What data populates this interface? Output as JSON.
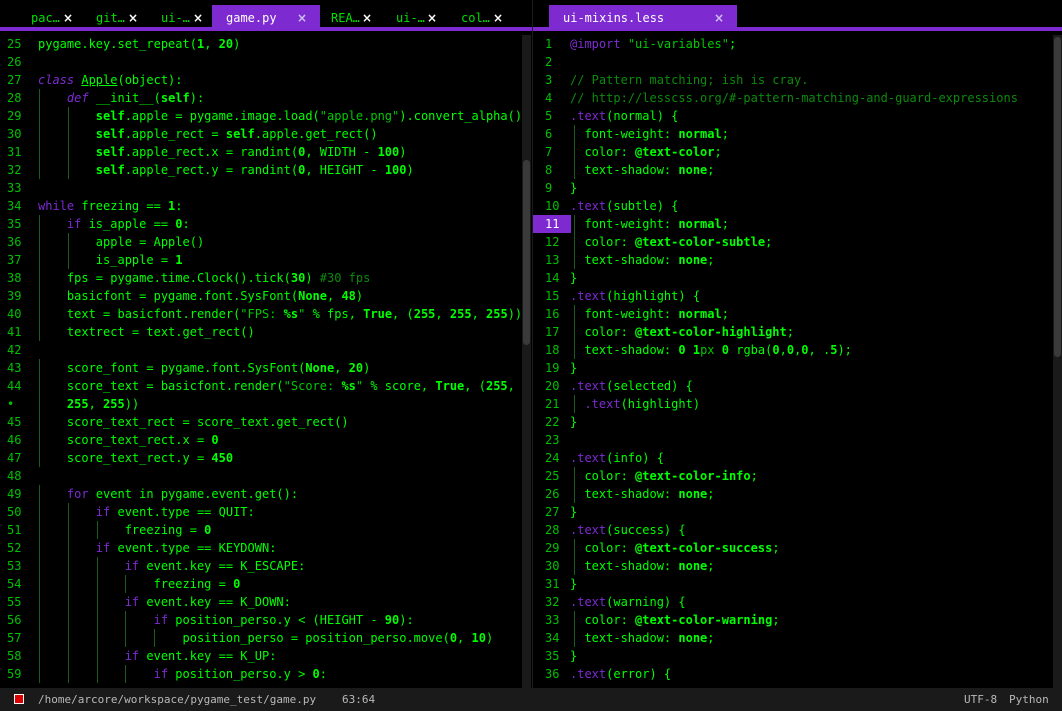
{
  "left_tabs": [
    {
      "label": "pac…",
      "close": "×",
      "active": false
    },
    {
      "label": "git…",
      "close": "×",
      "active": false
    },
    {
      "label": "ui-…",
      "close": "×",
      "active": false
    },
    {
      "label": "game.py",
      "close": "×",
      "active": true
    },
    {
      "label": "REA…",
      "close": "×",
      "active": false
    },
    {
      "label": "ui-…",
      "close": "×",
      "active": false
    },
    {
      "label": "col…",
      "close": "×",
      "active": false
    }
  ],
  "right_tabs": [
    {
      "label": "ui-mixins.less",
      "close": "×",
      "active": true
    }
  ],
  "left_code": [
    {
      "n": "25",
      "t": "pygame.key.set_repeat(<b>1</b>, <b>20</b>)"
    },
    {
      "n": "26",
      "t": ""
    },
    {
      "n": "27",
      "t": "<i>class</i> <u>Apple</u>(object):"
    },
    {
      "n": "28",
      "t": "    <i>def</i> __init__(<B>self</B>):"
    },
    {
      "n": "29",
      "t": "        <B>self</B>.apple = pygame.image.load(<s>\"apple.png\"</s>).convert_alpha()"
    },
    {
      "n": "30",
      "t": "        <B>self</B>.apple_rect = <B>self</B>.apple.get_rect()"
    },
    {
      "n": "31",
      "t": "        <B>self</B>.apple_rect.x = randint(<b>0</b>, WIDTH - <b>100</b>)"
    },
    {
      "n": "32",
      "t": "        <B>self</B>.apple_rect.y = randint(<b>0</b>, HEIGHT - <b>100</b>)"
    },
    {
      "n": "33",
      "t": ""
    },
    {
      "n": "34",
      "t": "<k>while</k> freezing == <b>1</b>:"
    },
    {
      "n": "35",
      "t": "    <k>if</k> is_apple == <b>0</b>:"
    },
    {
      "n": "36",
      "t": "        apple = Apple()"
    },
    {
      "n": "37",
      "t": "        is_apple = <b>1</b>"
    },
    {
      "n": "38",
      "t": "    fps = pygame.time.Clock().tick(<b>30</b>) <c>#30 fps</c>"
    },
    {
      "n": "39",
      "t": "    basicfont = pygame.font.SysFont(<b>None</b>, <b>48</b>)"
    },
    {
      "n": "40",
      "t": "    text = basicfont.render(<s>\"FPS: </s><b>%s</b><s>\"</s> % fps, <b>True</b>, (<b>255</b>, <b>255</b>, <b>255</b>))"
    },
    {
      "n": "41",
      "t": "    textrect = text.get_rect()"
    },
    {
      "n": "42",
      "t": ""
    },
    {
      "n": "43",
      "t": "    score_font = pygame.font.SysFont(<b>None</b>, <b>20</b>)"
    },
    {
      "n": "44",
      "t": "    score_text = basicfont.render(<s>\"Score: </s><b>%s</b><s>\"</s> % score, <b>True</b>, (<b>255</b>,"
    },
    {
      "n": "•",
      "t": "    <b>255</b>, <b>255</b>))"
    },
    {
      "n": "45",
      "t": "    score_text_rect = score_text.get_rect()"
    },
    {
      "n": "46",
      "t": "    score_text_rect.x = <b>0</b>"
    },
    {
      "n": "47",
      "t": "    score_text_rect.y = <b>450</b>"
    },
    {
      "n": "48",
      "t": ""
    },
    {
      "n": "49",
      "t": "    <k>for</k> event in pygame.event.get():"
    },
    {
      "n": "50",
      "t": "        <k>if</k> event.type == QUIT:"
    },
    {
      "n": "51",
      "t": "            freezing = <b>0</b>"
    },
    {
      "n": "52",
      "t": "        <k>if</k> event.type == KEYDOWN:"
    },
    {
      "n": "53",
      "t": "            <k>if</k> event.key == K_ESCAPE:"
    },
    {
      "n": "54",
      "t": "                freezing = <b>0</b>"
    },
    {
      "n": "55",
      "t": "            <k>if</k> event.key == K_DOWN:"
    },
    {
      "n": "56",
      "t": "                <k>if</k> position_perso.y &lt; (HEIGHT - <b>90</b>):"
    },
    {
      "n": "57",
      "t": "                    position_perso = position_perso.move(<b>0</b>, <b>10</b>)"
    },
    {
      "n": "58",
      "t": "            <k>if</k> event.key == K_UP:"
    },
    {
      "n": "59",
      "t": "                <k>if</k> position_perso.y &gt; <b>0</b>:"
    }
  ],
  "right_code": [
    {
      "n": "1",
      "t": "<k>@import</k> <s>\"ui-variables\"</s>;"
    },
    {
      "n": "2",
      "t": ""
    },
    {
      "n": "3",
      "t": "<c>// Pattern matching; ish is cray.</c>"
    },
    {
      "n": "4",
      "t": "<c>// http://lesscss.org/#-pattern-matching-and-guard-expressions</c>"
    },
    {
      "n": "5",
      "t": "<k>.text</k>(normal) {"
    },
    {
      "n": "6",
      "t": "  font-weight: <b>normal</b>;"
    },
    {
      "n": "7",
      "t": "  color: <b>@text-color</b>;"
    },
    {
      "n": "8",
      "t": "  text-shadow: <b>none</b>;"
    },
    {
      "n": "9",
      "t": "}"
    },
    {
      "n": "10",
      "t": "<k>.text</k>(subtle) {"
    },
    {
      "n": "11",
      "t": "  font-weight: <b>normal</b>;",
      "hl": true
    },
    {
      "n": "12",
      "t": "  color: <b>@text-color-subtle</b>;"
    },
    {
      "n": "13",
      "t": "  text-shadow: <b>none</b>;"
    },
    {
      "n": "14",
      "t": "}"
    },
    {
      "n": "15",
      "t": "<k>.text</k>(highlight) {"
    },
    {
      "n": "16",
      "t": "  font-weight: <b>normal</b>;"
    },
    {
      "n": "17",
      "t": "  color: <b>@text-color-highlight</b>;"
    },
    {
      "n": "18",
      "t": "  text-shadow: <b>0</b> <b>1</b><s>px</s> <b>0</b> rgba(<b>0</b>,<b>0</b>,<b>0</b>, .<b>5</b>);"
    },
    {
      "n": "19",
      "t": "}"
    },
    {
      "n": "20",
      "t": "<k>.text</k>(selected) {"
    },
    {
      "n": "21",
      "t": "  <k>.text</k>(highlight)"
    },
    {
      "n": "22",
      "t": "}"
    },
    {
      "n": "23",
      "t": ""
    },
    {
      "n": "24",
      "t": "<k>.text</k>(info) {"
    },
    {
      "n": "25",
      "t": "  color: <b>@text-color-info</b>;"
    },
    {
      "n": "26",
      "t": "  text-shadow: <b>none</b>;"
    },
    {
      "n": "27",
      "t": "}"
    },
    {
      "n": "28",
      "t": "<k>.text</k>(success) {"
    },
    {
      "n": "29",
      "t": "  color: <b>@text-color-success</b>;"
    },
    {
      "n": "30",
      "t": "  text-shadow: <b>none</b>;"
    },
    {
      "n": "31",
      "t": "}"
    },
    {
      "n": "32",
      "t": "<k>.text</k>(warning) {"
    },
    {
      "n": "33",
      "t": "  color: <b>@text-color-warning</b>;"
    },
    {
      "n": "34",
      "t": "  text-shadow: <b>none</b>;"
    },
    {
      "n": "35",
      "t": "}"
    },
    {
      "n": "36",
      "t": "<k>.text</k>(error) {"
    }
  ],
  "status": {
    "path": "/home/arcore/workspace/pygame_test/game.py",
    "cursor": "63:64",
    "encoding": "UTF-8",
    "grammar": "Python"
  },
  "colors": {
    "accent": "#7d2bd1",
    "text": "#00ff00",
    "background": "#000000"
  }
}
